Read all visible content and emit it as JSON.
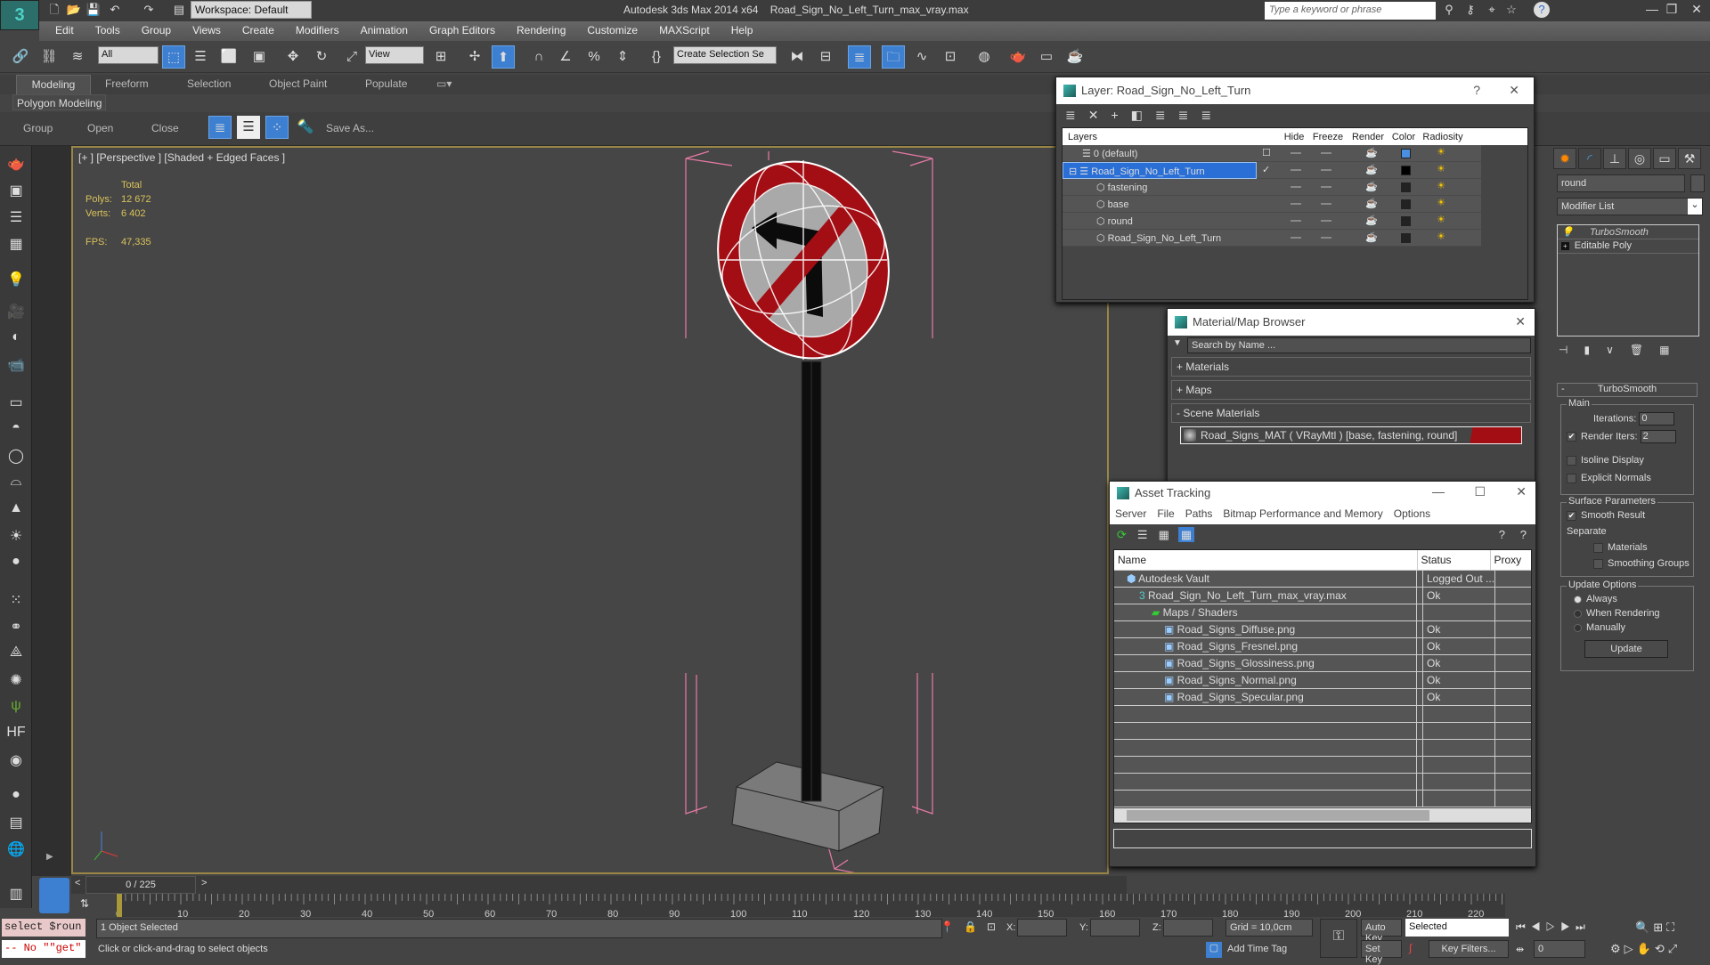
{
  "app": {
    "title": "Autodesk 3ds Max  2014 x64",
    "file": "Road_Sign_No_Left_Turn_max_vray.max",
    "workspace": "Workspace: Default",
    "search_placeholder": "Type a keyword or phrase"
  },
  "menu": [
    "Edit",
    "Tools",
    "Group",
    "Views",
    "Create",
    "Modifiers",
    "Animation",
    "Graph Editors",
    "Rendering",
    "Customize",
    "MAXScript",
    "Help"
  ],
  "toolbar": {
    "selection_filter": "All",
    "ref_coord": "View",
    "named_selection": "Create Selection Se"
  },
  "ribbon": {
    "tabs": [
      "Modeling",
      "Freeform",
      "Selection",
      "Object Paint",
      "Populate"
    ],
    "active_tab": "Modeling",
    "panel": "Polygon Modeling",
    "buttons": [
      "Group",
      "Open",
      "Close"
    ],
    "save_as": "Save As..."
  },
  "viewport": {
    "label": "[+ ] [Perspective ] [Shaded + Edged Faces ]",
    "stats": {
      "header": "Total",
      "polys_label": "Polys:",
      "polys": "12 672",
      "verts_label": "Verts:",
      "verts": "6 402",
      "fps_label": "FPS:",
      "fps": "47,335"
    }
  },
  "layer_window": {
    "title": "Layer: Road_Sign_No_Left_Turn",
    "columns": [
      "Layers",
      "",
      "Hide",
      "Freeze",
      "Render",
      "Color",
      "Radiosity"
    ],
    "rows": [
      {
        "name": "0 (default)",
        "indent": 1,
        "type": "layer",
        "active": "box",
        "color": "#4a8fe0"
      },
      {
        "name": "Road_Sign_No_Left_Turn",
        "indent": 0,
        "type": "layer",
        "active": "check",
        "color": "#000000",
        "selected": true
      },
      {
        "name": "fastening",
        "indent": 2,
        "type": "object",
        "color": "#222222"
      },
      {
        "name": "base",
        "indent": 2,
        "type": "object",
        "color": "#222222"
      },
      {
        "name": "round",
        "indent": 2,
        "type": "object",
        "color": "#222222"
      },
      {
        "name": "Road_Sign_No_Left_Turn",
        "indent": 2,
        "type": "object",
        "color": "#222222"
      }
    ]
  },
  "material_browser": {
    "title": "Material/Map Browser",
    "search_placeholder": "Search by Name ...",
    "sections": [
      "+ Materials",
      "+ Maps",
      "- Scene Materials"
    ],
    "material": "Road_Signs_MAT  ( VRayMtl )  [base, fastening, round]"
  },
  "asset_tracking": {
    "title": "Asset Tracking",
    "menu": [
      "Server",
      "File",
      "Paths",
      "Bitmap Performance and Memory",
      "Options"
    ],
    "columns": [
      "Name",
      "Status",
      "Proxy"
    ],
    "rows": [
      {
        "name": "Autodesk Vault",
        "status": "Logged Out ...",
        "indent": 1,
        "icon": "vault-icon"
      },
      {
        "name": "Road_Sign_No_Left_Turn_max_vray.max",
        "status": "Ok",
        "indent": 2,
        "icon": "max-file-icon"
      },
      {
        "name": "Maps / Shaders",
        "status": "",
        "indent": 3,
        "icon": "maps-icon"
      },
      {
        "name": "Road_Signs_Diffuse.png",
        "status": "Ok",
        "indent": 4,
        "icon": "image-file-icon"
      },
      {
        "name": "Road_Signs_Fresnel.png",
        "status": "Ok",
        "indent": 4,
        "icon": "image-file-icon"
      },
      {
        "name": "Road_Signs_Glossiness.png",
        "status": "Ok",
        "indent": 4,
        "icon": "image-file-icon"
      },
      {
        "name": "Road_Signs_Normal.png",
        "status": "Ok",
        "indent": 4,
        "icon": "image-file-icon"
      },
      {
        "name": "Road_Signs_Specular.png",
        "status": "Ok",
        "indent": 4,
        "icon": "image-file-icon"
      }
    ]
  },
  "command_panel": {
    "object_name": "round",
    "modifier_list": "Modifier List",
    "stack": [
      "TurboSmooth",
      "Editable Poly"
    ],
    "rollout": "TurboSmooth",
    "main_label": "Main",
    "iterations_label": "Iterations:",
    "iterations": "0",
    "render_iters_label": "Render Iters:",
    "render_iters": "2",
    "isoline": "Isoline Display",
    "explicit_normals": "Explicit Normals",
    "surface_label": "Surface Parameters",
    "smooth_result": "Smooth Result",
    "separate": "Separate",
    "materials": "Materials",
    "smoothing_groups": "Smoothing Groups",
    "update_label": "Update Options",
    "always": "Always",
    "when_rendering": "When Rendering",
    "manually": "Manually",
    "update_btn": "Update"
  },
  "timeline": {
    "frame": "0 / 225",
    "ticks": [
      "0",
      "10",
      "20",
      "30",
      "40",
      "50",
      "60",
      "70",
      "80",
      "90",
      "100",
      "110",
      "120",
      "130",
      "140",
      "150",
      "160",
      "170",
      "180",
      "190",
      "200",
      "210",
      "220"
    ]
  },
  "status": {
    "maxscript_1": "select $roun",
    "maxscript_2": "-- No \"\"get\"",
    "selected": "1 Object Selected",
    "prompt": "Click or click-and-drag to select objects",
    "x_label": "X:",
    "y_label": "Y:",
    "z_label": "Z:",
    "grid": "Grid = 10,0cm",
    "add_time_tag": "Add Time Tag",
    "auto_key": "Auto Key",
    "set_key": "Set Key",
    "key_mode": "Selected",
    "key_filters": "Key Filters...",
    "current_frame": "0"
  }
}
